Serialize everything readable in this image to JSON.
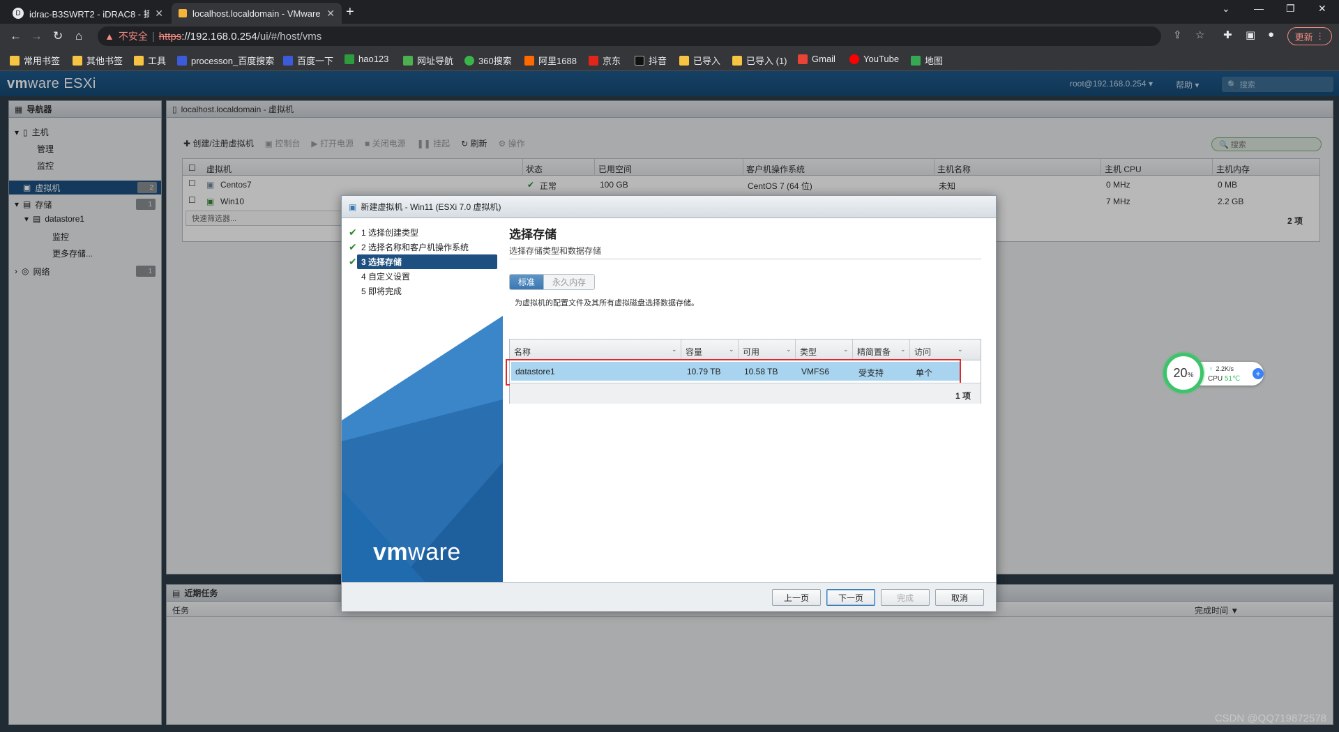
{
  "browser": {
    "tabs": [
      {
        "title": "idrac-B3SWRT2 - iDRAC8 - 摘要",
        "active": false
      },
      {
        "title": "localhost.localdomain - VMware ESXi",
        "active": true
      }
    ],
    "url_scheme": "https",
    "url_host": "://192.168.0.254",
    "url_path": "/ui/#/host/vms",
    "insecure_label": "不安全",
    "update_label": "更新",
    "bookmarks": [
      "常用书签",
      "其他书签",
      "工具",
      "processon_百度搜索",
      "百度一下",
      "hao123",
      "网址导航",
      "360搜索",
      "阿里1688",
      "京东",
      "抖音",
      "已导入",
      "已导入 (1)",
      "Gmail",
      "YouTube",
      "地图"
    ]
  },
  "esxi": {
    "logo": "ESXi",
    "user": "root@192.168.0.254",
    "help": "帮助",
    "search_placeholder": "搜索",
    "navigator": {
      "title": "导航器",
      "host": "主机",
      "manage": "管理",
      "monitor": "监控",
      "vms": "虚拟机",
      "vms_count": "2",
      "storage": "存储",
      "storage_count": "1",
      "datastore": "datastore1",
      "ds_monitor": "监控",
      "more_storage": "更多存储...",
      "network": "网络",
      "network_count": "1"
    },
    "content": {
      "breadcrumb": "localhost.localdomain - 虚拟机",
      "toolbar": [
        "创建/注册虚拟机",
        "控制台",
        "打开电源",
        "关闭电源",
        "挂起",
        "刷新",
        "操作"
      ],
      "search_placeholder": "搜索",
      "columns": [
        "虚拟机",
        "状态",
        "已用空间",
        "客户机操作系统",
        "主机名称",
        "主机 CPU",
        "主机内存"
      ],
      "rows": [
        {
          "name": "Centos7",
          "status": "正常",
          "used": "100 GB",
          "os": "CentOS 7 (64 位)",
          "host": "未知",
          "cpu": "0 MHz",
          "mem": "0 MB"
        },
        {
          "name": "Win10",
          "status": "",
          "used": "",
          "os": "",
          "host": "",
          "cpu": "7 MHz",
          "mem": "2.2 GB"
        }
      ],
      "quick_filter": "快速筛选器...",
      "count": "2 项"
    },
    "tasks": {
      "title": "近期任务",
      "columns": [
        "任务",
        "完成时间 ▼"
      ]
    }
  },
  "dialog": {
    "title": "新建虚拟机 - Win11 (ESXi 7.0 虚拟机)",
    "steps": [
      {
        "label": "1 选择创建类型",
        "done": true
      },
      {
        "label": "2 选择名称和客户机操作系统",
        "done": true
      },
      {
        "label": "3 选择存储",
        "done": true,
        "current": true
      },
      {
        "label": "4 自定义设置",
        "done": false
      },
      {
        "label": "5 即将完成",
        "done": false
      }
    ],
    "heading": "选择存储",
    "subheading": "选择存储类型和数据存储",
    "seg_standard": "标准",
    "seg_persistent": "永久内存",
    "description": "为虚拟机的配置文件及其所有虚拟磁盘选择数据存储。",
    "columns": [
      "名称",
      "容量",
      "可用",
      "类型",
      "精简置备",
      "访问"
    ],
    "datastores": [
      {
        "name": "datastore1",
        "capacity": "10.79 TB",
        "free": "10.58 TB",
        "type": "VMFS6",
        "thin": "受支持",
        "access": "单个"
      }
    ],
    "count": "1 项",
    "vmware_logo": "vmware",
    "buttons": {
      "back": "上一页",
      "next": "下一页",
      "finish": "完成",
      "cancel": "取消"
    }
  },
  "widget": {
    "percent": "20",
    "percent_sign": "%",
    "speed": "2.2K/s",
    "cpu_label": "CPU",
    "cpu_temp": "51℃"
  },
  "watermark": "CSDN @QQ719872578"
}
